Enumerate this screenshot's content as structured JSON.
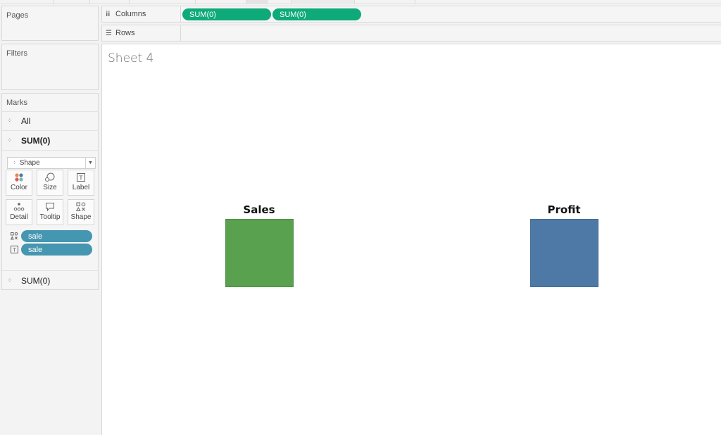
{
  "panels": {
    "pages_title": "Pages",
    "filters_title": "Filters",
    "marks_title": "Marks"
  },
  "shelves": {
    "columns_label": "Columns",
    "rows_label": "Rows",
    "column_pills": [
      "SUM(0)",
      "SUM(0)"
    ]
  },
  "marks": {
    "all_label": "All",
    "selected_measure": "SUM(0)",
    "mark_type": "Shape",
    "cards": [
      "Color",
      "Size",
      "Label",
      "Detail",
      "Tooltip",
      "Shape"
    ],
    "fields": [
      {
        "icon": "shape-encoding-icon",
        "name": "sale"
      },
      {
        "icon": "label-encoding-icon",
        "name": "sale"
      }
    ],
    "second_measure": "SUM(0)"
  },
  "view": {
    "sheet_title": "Sheet 4",
    "items": [
      {
        "label": "Sales",
        "color": "#59a14f"
      },
      {
        "label": "Profit",
        "color": "#4e79a7"
      }
    ]
  },
  "colors": {
    "column_pill": "#0eaa79",
    "field_pill": "#4596b0"
  }
}
